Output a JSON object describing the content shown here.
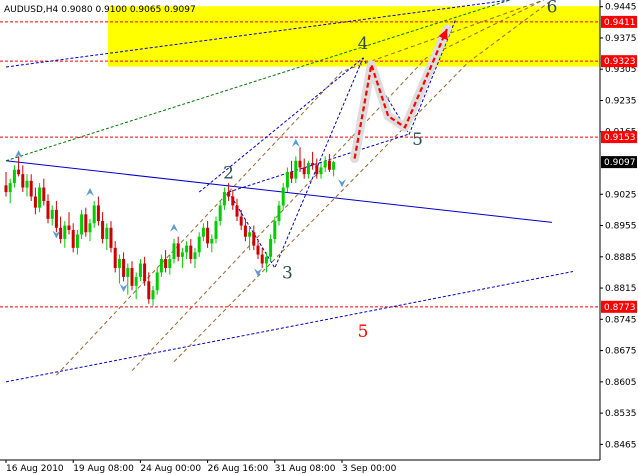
{
  "chart_data": {
    "type": "candlestick",
    "title": "AUDUSD,H4  0.9080 0.9100 0.9065 0.9097",
    "symbol": "AUDUSD,H4",
    "ohlc": {
      "open": 0.908,
      "high": 0.91,
      "low": 0.9065,
      "close": 0.9097
    },
    "ylim": [
      0.843,
      0.946
    ],
    "y_ticks": [
      "0.9445",
      "0.9375",
      "0.9305",
      "0.9235",
      "0.9165",
      "0.9025",
      "0.8955",
      "0.8885",
      "0.8815",
      "0.8745",
      "0.8675",
      "0.8605",
      "0.8535",
      "0.8465"
    ],
    "y_tick_values": [
      0.9445,
      0.9375,
      0.9305,
      0.9235,
      0.9165,
      0.9025,
      0.8955,
      0.8885,
      0.8815,
      0.8745,
      0.8675,
      0.8605,
      0.8535,
      0.8465
    ],
    "x_ticks": [
      "16 Aug 2010",
      "19 Aug 08:00",
      "24 Aug 00:00",
      "26 Aug 16:00",
      "31 Aug 08:00",
      "3 Sep 00:00"
    ],
    "x_tick_bars": [
      0,
      16,
      32,
      48,
      64,
      80
    ],
    "bar_count": 100,
    "price_levels": [
      {
        "label": "0.9411",
        "value": 0.9411,
        "color": "#ff0000"
      },
      {
        "label": "0.9323",
        "value": 0.9323,
        "color": "#ff0000"
      },
      {
        "label": "0.9153",
        "value": 0.9153,
        "color": "#ff0000"
      },
      {
        "label": "0.8773",
        "value": 0.8773,
        "color": "#ff0000"
      }
    ],
    "current_price": {
      "label": "0.9097",
      "value": 0.9097
    },
    "target_zone": {
      "from": 0.9323,
      "to": 0.9411,
      "color": "#ffff00"
    },
    "wave_labels": [
      {
        "text": "2",
        "bar": 53,
        "value": 0.906,
        "color": "#2f4f4f"
      },
      {
        "text": "3",
        "bar": 67,
        "value": 0.8836,
        "color": "#2f4f4f"
      },
      {
        "text": "4",
        "bar": 85,
        "value": 0.935,
        "color": "#2f4f4f"
      },
      {
        "text": "5",
        "bar": 98,
        "value": 0.9135,
        "color": "#2f4f4f"
      },
      {
        "text": "6",
        "bar": 130,
        "value": 0.9432,
        "color": "#2f4f4f"
      },
      {
        "text": "5",
        "bar": 85,
        "value": 0.8705,
        "color": "#ff0000"
      }
    ],
    "candles": [
      [
        0.9045,
        0.9075,
        0.902,
        0.903
      ],
      [
        0.903,
        0.906,
        0.9005,
        0.905
      ],
      [
        0.905,
        0.909,
        0.904,
        0.908
      ],
      [
        0.908,
        0.911,
        0.9065,
        0.907
      ],
      [
        0.907,
        0.909,
        0.903,
        0.904
      ],
      [
        0.904,
        0.907,
        0.902,
        0.9055
      ],
      [
        0.9055,
        0.907,
        0.901,
        0.902
      ],
      [
        0.902,
        0.904,
        0.898,
        0.8995
      ],
      [
        0.8995,
        0.905,
        0.8985,
        0.904
      ],
      [
        0.904,
        0.906,
        0.9,
        0.901
      ],
      [
        0.901,
        0.9025,
        0.896,
        0.897
      ],
      [
        0.897,
        0.9,
        0.8955,
        0.899
      ],
      [
        0.899,
        0.901,
        0.894,
        0.895
      ],
      [
        0.895,
        0.8975,
        0.8915,
        0.8925
      ],
      [
        0.8925,
        0.8965,
        0.8905,
        0.8955
      ],
      [
        0.8955,
        0.8985,
        0.8935,
        0.8945
      ],
      [
        0.8945,
        0.896,
        0.8895,
        0.8905
      ],
      [
        0.8905,
        0.8945,
        0.889,
        0.8935
      ],
      [
        0.8935,
        0.899,
        0.8925,
        0.898
      ],
      [
        0.898,
        0.8995,
        0.893,
        0.894
      ],
      [
        0.894,
        0.897,
        0.892,
        0.896
      ],
      [
        0.896,
        0.901,
        0.895,
        0.9
      ],
      [
        0.9,
        0.902,
        0.8955,
        0.8965
      ],
      [
        0.8965,
        0.8985,
        0.8915,
        0.8925
      ],
      [
        0.8925,
        0.896,
        0.89,
        0.895
      ],
      [
        0.895,
        0.8965,
        0.8895,
        0.8905
      ],
      [
        0.8905,
        0.892,
        0.885,
        0.886
      ],
      [
        0.886,
        0.889,
        0.8825,
        0.888
      ],
      [
        0.888,
        0.8895,
        0.883,
        0.884
      ],
      [
        0.884,
        0.887,
        0.88,
        0.886
      ],
      [
        0.886,
        0.8875,
        0.881,
        0.882
      ],
      [
        0.882,
        0.885,
        0.879,
        0.884
      ],
      [
        0.884,
        0.888,
        0.883,
        0.887
      ],
      [
        0.887,
        0.8885,
        0.882,
        0.883
      ],
      [
        0.883,
        0.885,
        0.878,
        0.879
      ],
      [
        0.879,
        0.882,
        0.8775,
        0.881
      ],
      [
        0.881,
        0.886,
        0.88,
        0.885
      ],
      [
        0.885,
        0.889,
        0.884,
        0.888
      ],
      [
        0.888,
        0.89,
        0.885,
        0.886
      ],
      [
        0.886,
        0.889,
        0.8845,
        0.888
      ],
      [
        0.888,
        0.8925,
        0.887,
        0.8915
      ],
      [
        0.8915,
        0.893,
        0.8875,
        0.8885
      ],
      [
        0.8885,
        0.8905,
        0.886,
        0.8895
      ],
      [
        0.8895,
        0.892,
        0.888,
        0.891
      ],
      [
        0.891,
        0.8925,
        0.887,
        0.888
      ],
      [
        0.888,
        0.8905,
        0.886,
        0.8895
      ],
      [
        0.8895,
        0.894,
        0.8885,
        0.893
      ],
      [
        0.893,
        0.896,
        0.892,
        0.895
      ],
      [
        0.895,
        0.8965,
        0.8905,
        0.8915
      ],
      [
        0.8915,
        0.8935,
        0.8895,
        0.8925
      ],
      [
        0.8925,
        0.8975,
        0.8915,
        0.8965
      ],
      [
        0.8965,
        0.901,
        0.8955,
        0.9
      ],
      [
        0.9,
        0.904,
        0.899,
        0.903
      ],
      [
        0.903,
        0.905,
        0.901,
        0.902
      ],
      [
        0.902,
        0.9035,
        0.899,
        0.9
      ],
      [
        0.9,
        0.9015,
        0.8965,
        0.8975
      ],
      [
        0.8975,
        0.899,
        0.8945,
        0.8955
      ],
      [
        0.8955,
        0.897,
        0.892,
        0.893
      ],
      [
        0.893,
        0.895,
        0.89,
        0.894
      ],
      [
        0.894,
        0.8955,
        0.89,
        0.891
      ],
      [
        0.891,
        0.8925,
        0.888,
        0.889
      ],
      [
        0.889,
        0.8905,
        0.886,
        0.887
      ],
      [
        0.887,
        0.8895,
        0.885,
        0.8885
      ],
      [
        0.8885,
        0.8935,
        0.8875,
        0.8925
      ],
      [
        0.8925,
        0.8975,
        0.8915,
        0.8965
      ],
      [
        0.8965,
        0.901,
        0.8955,
        0.9
      ],
      [
        0.9,
        0.905,
        0.899,
        0.904
      ],
      [
        0.904,
        0.9085,
        0.903,
        0.9075
      ],
      [
        0.9075,
        0.91,
        0.905,
        0.906
      ],
      [
        0.906,
        0.911,
        0.905,
        0.91
      ],
      [
        0.91,
        0.913,
        0.9075,
        0.9085
      ],
      [
        0.9085,
        0.9105,
        0.906,
        0.907
      ],
      [
        0.907,
        0.91,
        0.906,
        0.9095
      ],
      [
        0.9095,
        0.912,
        0.908,
        0.909
      ],
      [
        0.909,
        0.9105,
        0.906,
        0.907
      ],
      [
        0.907,
        0.9095,
        0.906,
        0.9085
      ],
      [
        0.9085,
        0.911,
        0.9075,
        0.91
      ],
      [
        0.91,
        0.9115,
        0.9075,
        0.908
      ],
      [
        0.908,
        0.91,
        0.9065,
        0.9097
      ]
    ],
    "lines": [
      {
        "name": "",
        "color": "#0000cc",
        "dash": "",
        "points": [
          [
            0,
            0.91
          ],
          [
            130,
            0.8962
          ]
        ]
      },
      {
        "name": "",
        "color": "#0000cc",
        "dash": "3,2",
        "points": [
          [
            0,
            0.8605
          ],
          [
            135,
            0.8852
          ]
        ]
      },
      {
        "name": "",
        "color": "#0000cc",
        "dash": "3,2",
        "points": [
          [
            0,
            0.931
          ],
          [
            120,
            0.946
          ]
        ]
      },
      {
        "name": "",
        "color": "#007700",
        "dash": "3,2",
        "points": [
          [
            0,
            0.91
          ],
          [
            120,
            0.946
          ]
        ]
      },
      {
        "name": "",
        "color": "#0000cc",
        "dash": "3,2",
        "points": [
          [
            46,
            0.903
          ],
          [
            85,
            0.933
          ],
          [
            96,
            0.916
          ],
          [
            107,
            0.9415
          ]
        ]
      },
      {
        "name": "",
        "color": "#0000cc",
        "dash": "3,2",
        "points": [
          [
            53,
            0.903
          ],
          [
            64,
            0.886
          ],
          [
            85,
            0.933
          ]
        ]
      },
      {
        "name": "",
        "color": "#0000cc",
        "dash": "3,2",
        "points": [
          [
            53,
            0.903
          ],
          [
            96,
            0.916
          ]
        ]
      },
      {
        "name": "",
        "color": "#996633",
        "dash": "4,3",
        "points": [
          [
            12,
            0.862
          ],
          [
            80,
            0.93
          ],
          [
            128,
            0.946
          ]
        ]
      },
      {
        "name": "",
        "color": "#996633",
        "dash": "4,3",
        "points": [
          [
            30,
            0.863
          ],
          [
            100,
            0.933
          ],
          [
            128,
            0.946
          ]
        ]
      },
      {
        "name": "",
        "color": "#996633",
        "dash": "4,3",
        "points": [
          [
            40,
            0.865
          ],
          [
            110,
            0.932
          ],
          [
            130,
            0.946
          ]
        ]
      }
    ],
    "arrows_forecast": [
      {
        "color": "#ff0000",
        "points": [
          [
            83,
            0.9105
          ],
          [
            87,
            0.9315
          ],
          [
            91,
            0.92
          ],
          [
            95,
            0.9175
          ],
          [
            105,
            0.9395
          ]
        ]
      }
    ],
    "grid": false,
    "legend": "none"
  }
}
